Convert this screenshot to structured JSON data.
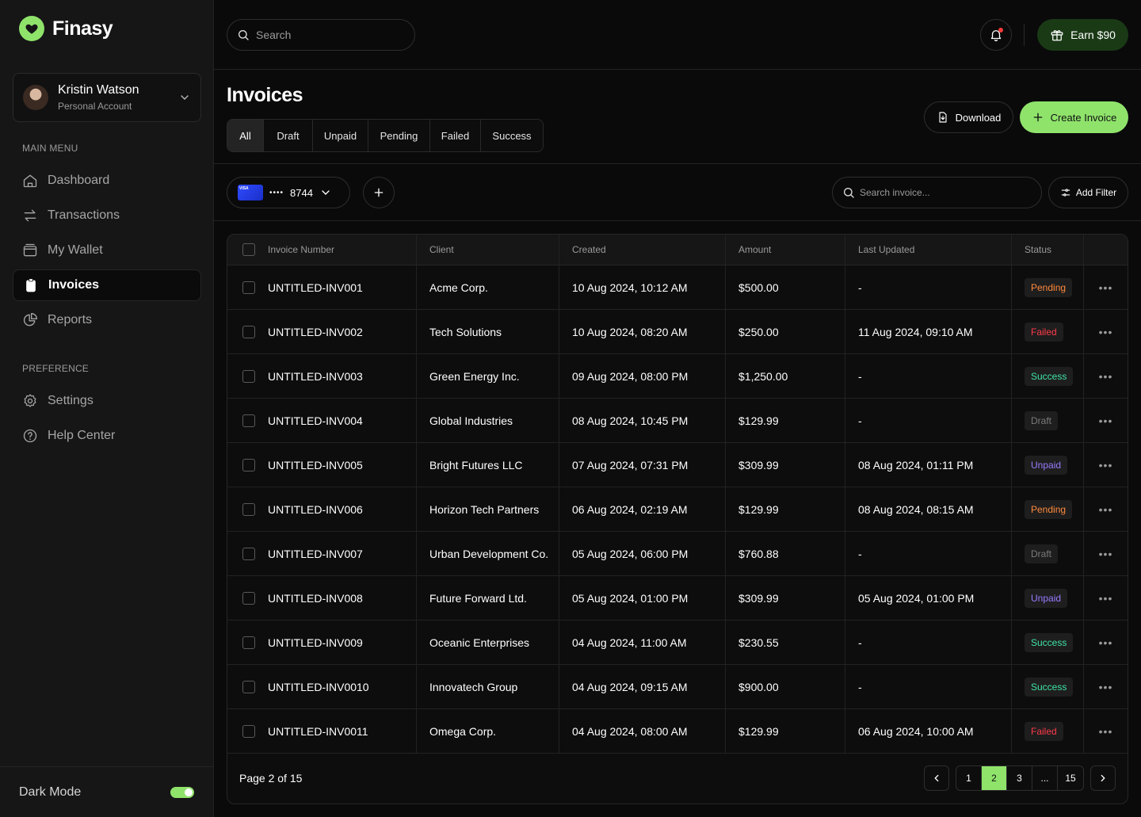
{
  "brand": {
    "name": "Finasy"
  },
  "account": {
    "name": "Kristin Watson",
    "type": "Personal Account"
  },
  "sidebar": {
    "main_menu_label": "MAIN MENU",
    "preference_label": "PREFERENCE",
    "main_items": [
      {
        "label": "Dashboard",
        "icon": "home-icon"
      },
      {
        "label": "Transactions",
        "icon": "transfer-icon"
      },
      {
        "label": "My Wallet",
        "icon": "wallet-icon"
      },
      {
        "label": "Invoices",
        "icon": "clipboard-icon",
        "active": true
      },
      {
        "label": "Reports",
        "icon": "pie-chart-icon"
      }
    ],
    "pref_items": [
      {
        "label": "Settings",
        "icon": "gear-icon"
      },
      {
        "label": "Help Center",
        "icon": "help-icon"
      }
    ],
    "dark_mode_label": "Dark Mode"
  },
  "topbar": {
    "search_placeholder": "Search",
    "earn_label": "Earn $90"
  },
  "header": {
    "title": "Invoices",
    "tabs": [
      "All",
      "Draft",
      "Unpaid",
      "Pending",
      "Failed",
      "Success"
    ],
    "download_label": "Download",
    "create_label": "Create Invoice"
  },
  "filters": {
    "card_brand": "VISA",
    "card_dots": "••••",
    "card_last4": "8744",
    "search_placeholder": "Search invoice...",
    "add_filter_label": "Add Filter"
  },
  "table": {
    "columns": [
      "Invoice Number",
      "Client",
      "Created",
      "Amount",
      "Last Updated",
      "Status"
    ],
    "rows": [
      {
        "number": "UNTITLED-INV001",
        "client": "Acme Corp.",
        "created": "10 Aug 2024, 10:12 AM",
        "amount": "$500.00",
        "updated": "-",
        "status": "Pending"
      },
      {
        "number": "UNTITLED-INV002",
        "client": "Tech Solutions",
        "created": "10 Aug 2024, 08:20 AM",
        "amount": "$250.00",
        "updated": "11 Aug 2024, 09:10 AM",
        "status": "Failed"
      },
      {
        "number": "UNTITLED-INV003",
        "client": "Green Energy Inc.",
        "created": "09 Aug 2024, 08:00 PM",
        "amount": "$1,250.00",
        "updated": "-",
        "status": "Success"
      },
      {
        "number": "UNTITLED-INV004",
        "client": "Global Industries",
        "created": "08 Aug 2024, 10:45 PM",
        "amount": "$129.99",
        "updated": "-",
        "status": "Draft"
      },
      {
        "number": "UNTITLED-INV005",
        "client": "Bright Futures LLC",
        "created": "07 Aug 2024, 07:31 PM",
        "amount": "$309.99",
        "updated": "08 Aug 2024, 01:11 PM",
        "status": "Unpaid"
      },
      {
        "number": "UNTITLED-INV006",
        "client": "Horizon Tech Partners",
        "created": "06 Aug 2024, 02:19 AM",
        "amount": "$129.99",
        "updated": "08 Aug 2024, 08:15 AM",
        "status": "Pending"
      },
      {
        "number": "UNTITLED-INV007",
        "client": "Urban Development Co.",
        "created": "05 Aug 2024, 06:00 PM",
        "amount": "$760.88",
        "updated": "-",
        "status": "Draft"
      },
      {
        "number": "UNTITLED-INV008",
        "client": "Future Forward Ltd.",
        "created": "05 Aug 2024, 01:00 PM",
        "amount": "$309.99",
        "updated": "05 Aug 2024, 01:00 PM",
        "status": "Unpaid"
      },
      {
        "number": "UNTITLED-INV009",
        "client": "Oceanic Enterprises",
        "created": "04 Aug 2024, 11:00 AM",
        "amount": "$230.55",
        "updated": "-",
        "status": "Success"
      },
      {
        "number": "UNTITLED-INV0010",
        "client": "Innovatech Group",
        "created": "04 Aug 2024, 09:15 AM",
        "amount": "$900.00",
        "updated": "-",
        "status": "Success"
      },
      {
        "number": "UNTITLED-INV0011",
        "client": "Omega Corp.",
        "created": "04 Aug 2024, 08:00 AM",
        "amount": "$129.99",
        "updated": "06 Aug 2024, 10:00 AM",
        "status": "Failed"
      }
    ]
  },
  "pagination": {
    "info": "Page 2 of 15",
    "pages": [
      "1",
      "2",
      "3",
      "...",
      "15"
    ],
    "current": "2"
  },
  "colors": {
    "accent": "#8fe36b",
    "background": "#0a0a0a",
    "sidebar": "#161616"
  }
}
